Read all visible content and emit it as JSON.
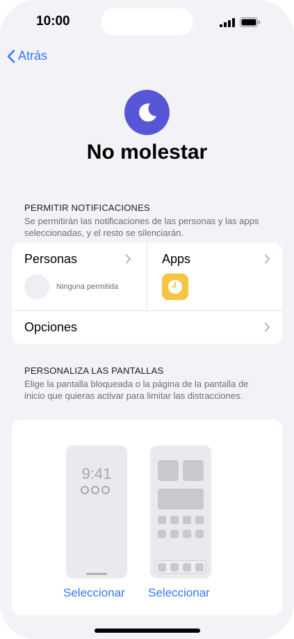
{
  "status_bar": {
    "time": "10:00",
    "icons": [
      "signal-icon",
      "battery-icon"
    ]
  },
  "nav": {
    "back_label": "Atrás",
    "back_icon": "chevron-left-icon"
  },
  "header": {
    "icon": "moon-icon",
    "icon_color": "#5856d6",
    "title": "No molestar"
  },
  "allow_notifications": {
    "header": "PERMITIR NOTIFICACIONES",
    "description": "Se permitirán las notificaciones de las personas y las apps seleccionadas, y el resto se silenciarán.",
    "people": {
      "label": "Personas",
      "empty_text": "Ninguna permitida"
    },
    "apps": {
      "label": "Apps",
      "app_icon": "clock-icon",
      "app_color": "#f7c544"
    },
    "options": {
      "label": "Opciones"
    }
  },
  "customize_screens": {
    "header": "PERSONALIZA LAS PANTALLAS",
    "description": "Elige la pantalla bloqueada o la página de la pantalla de inicio que quieras activar para limitar las distracciones.",
    "lock_screen": {
      "time": "9:41",
      "select_label": "Seleccionar"
    },
    "home_screen": {
      "select_label": "Seleccionar"
    }
  },
  "colors": {
    "accent": "#3478f6",
    "background": "#f2f2f7"
  }
}
